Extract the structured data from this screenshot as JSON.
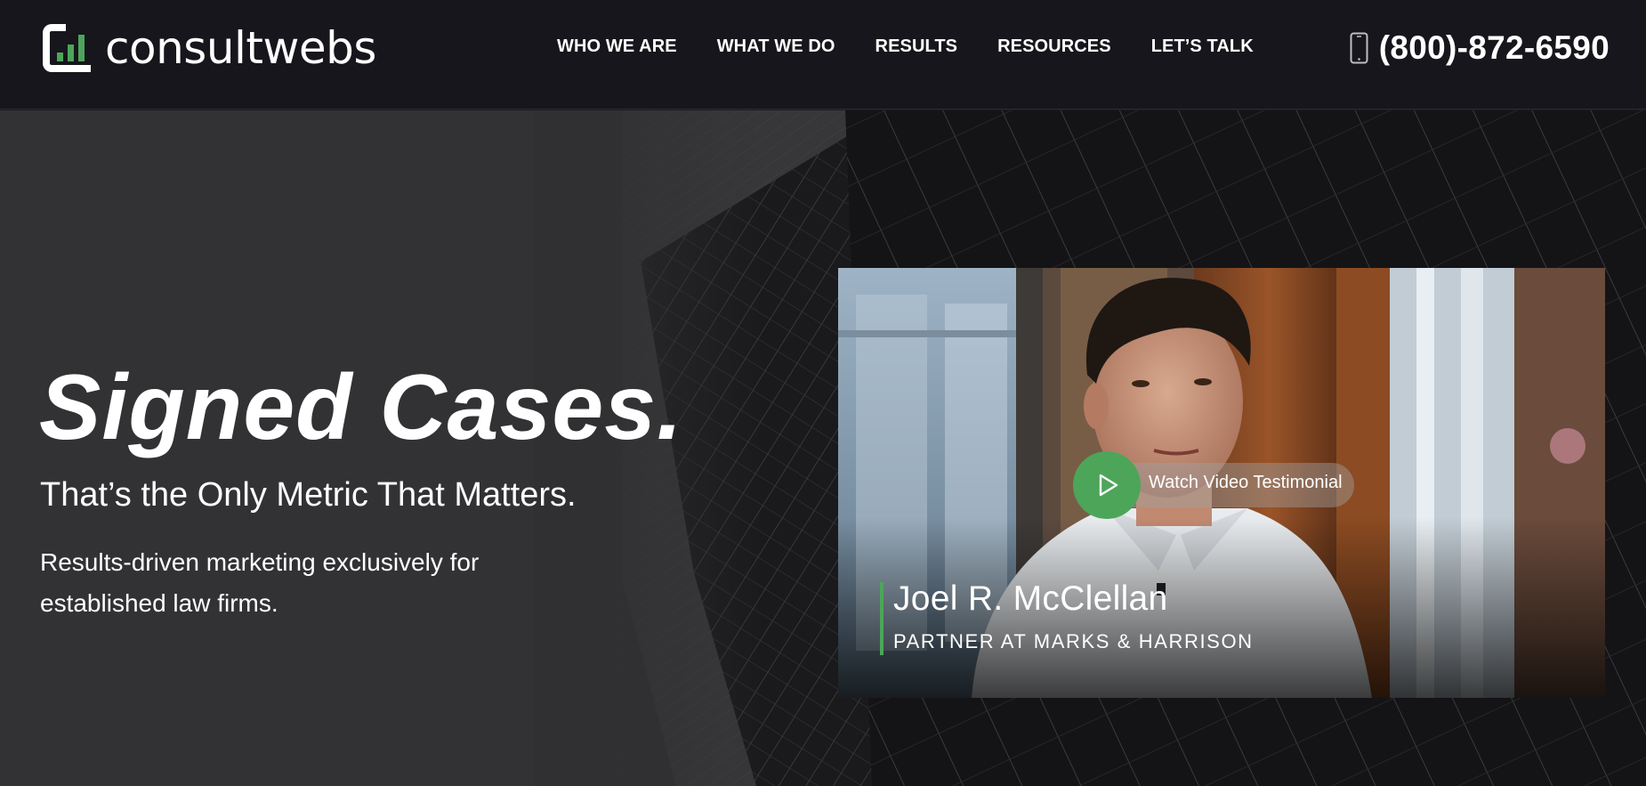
{
  "brand": {
    "name": "consultwebs",
    "accent_color": "#4da55a",
    "header_bg": "#16161c"
  },
  "nav": {
    "items": [
      {
        "label": "WHO WE ARE"
      },
      {
        "label": "WHAT WE DO"
      },
      {
        "label": "RESULTS"
      },
      {
        "label": "RESOURCES"
      },
      {
        "label": "LET’S TALK"
      }
    ]
  },
  "contact": {
    "icon": "mobile-phone-icon",
    "phone": "(800)-872-6590"
  },
  "hero": {
    "title": "Signed Cases.",
    "subtitle": "That’s the Only Metric That Matters.",
    "description": "Results-driven marketing exclusively for established law firms."
  },
  "video": {
    "play_icon": "play-icon",
    "watch_label": "Watch Video Testimonial",
    "person_name": "Joel R. McClellan",
    "person_title": "PARTNER AT MARKS & HARRISON"
  }
}
